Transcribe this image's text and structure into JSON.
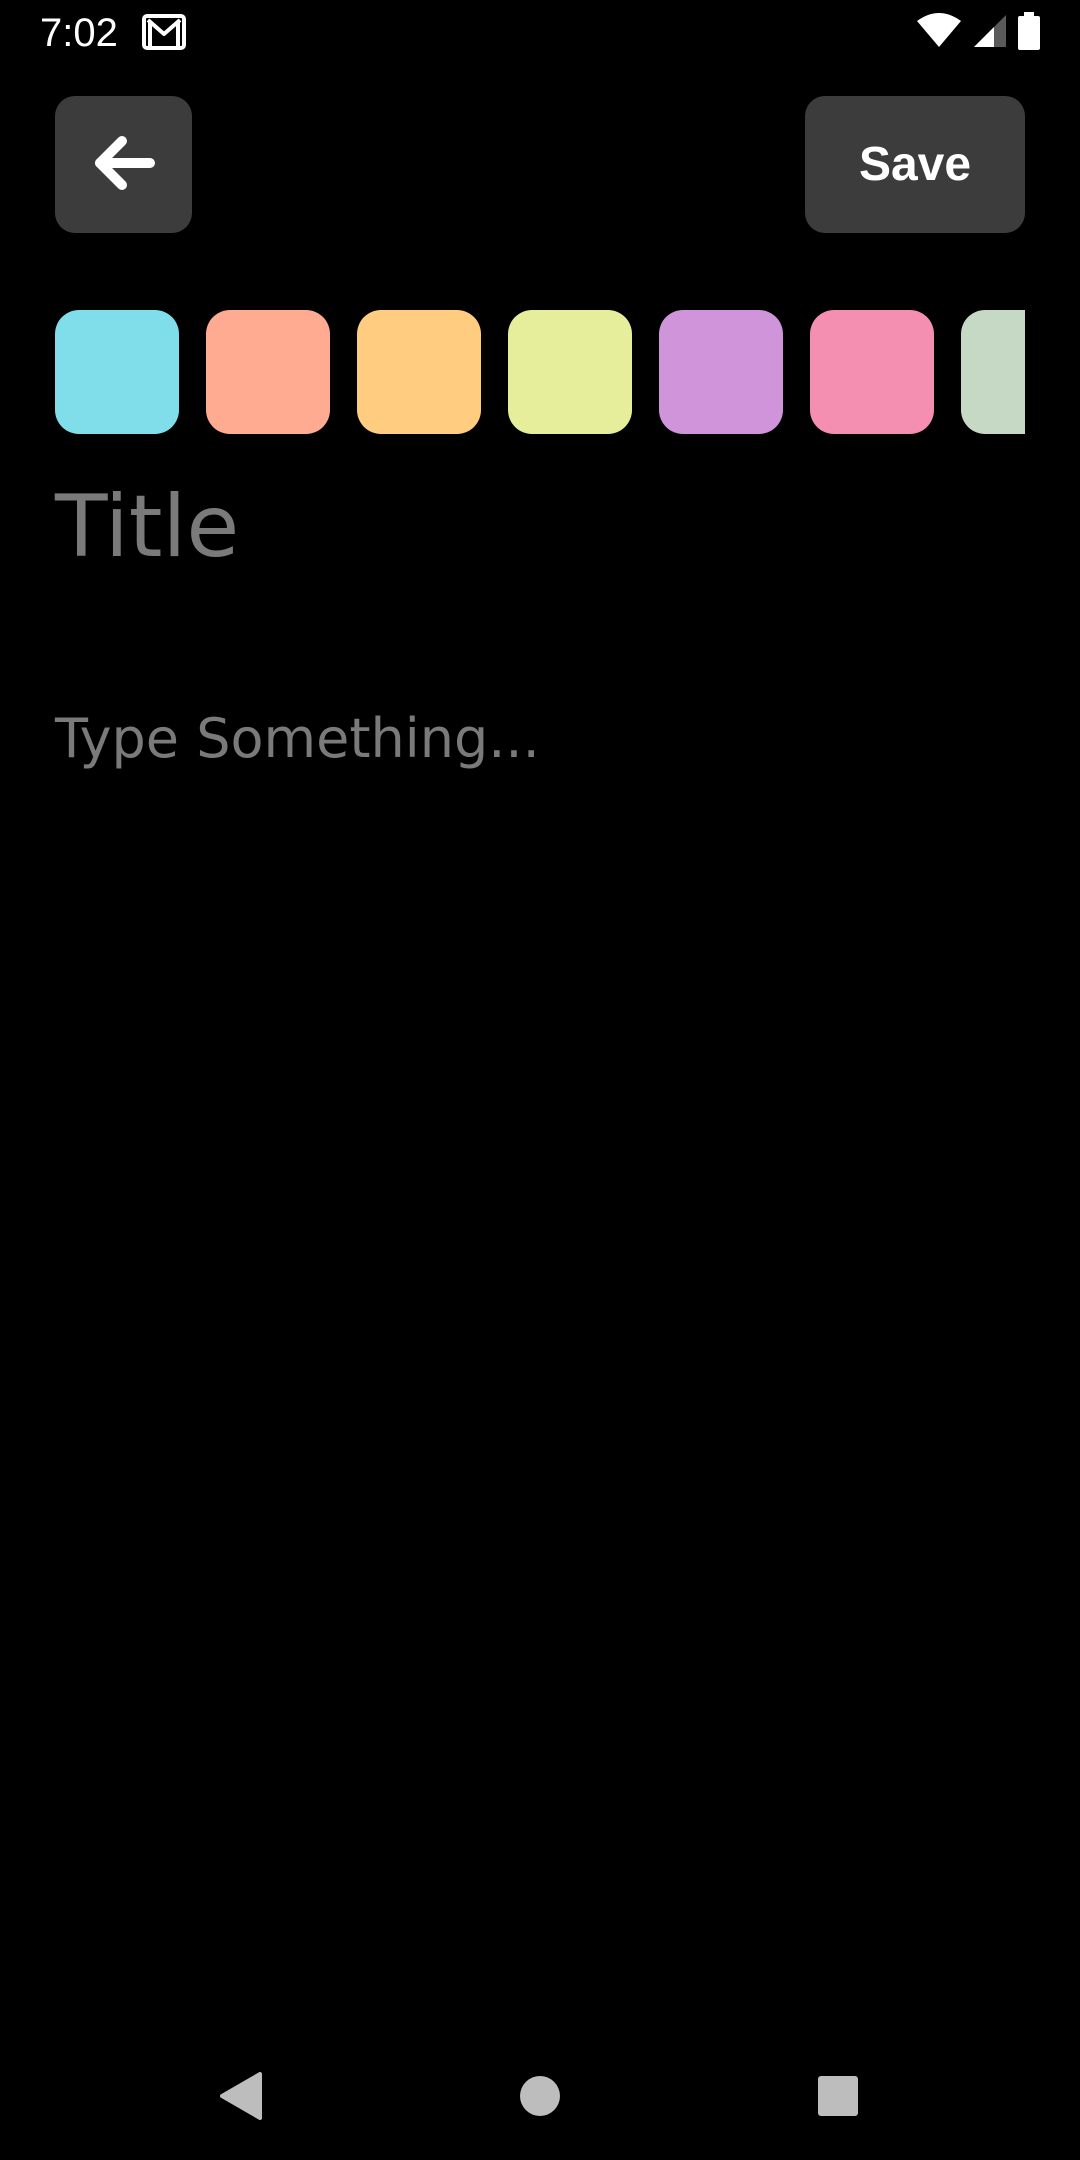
{
  "status_bar": {
    "time": "7:02",
    "icons": [
      "gmail-icon",
      "wifi-icon",
      "cellular-signal-icon",
      "battery-icon"
    ]
  },
  "toolbar": {
    "back_icon": "arrow-left-icon",
    "save_label": "Save",
    "button_bg": "#3c3c3c"
  },
  "palette": {
    "colors": [
      "#80deea",
      "#ffab91",
      "#ffcc80",
      "#e6ee9b",
      "#cf94da",
      "#f48fb1",
      "#c5d9c5"
    ]
  },
  "editor": {
    "title_placeholder": "Title",
    "body_placeholder": "Type Something..."
  },
  "nav_bar": {
    "icons": [
      "nav-back-icon",
      "nav-home-icon",
      "nav-recents-icon"
    ]
  }
}
